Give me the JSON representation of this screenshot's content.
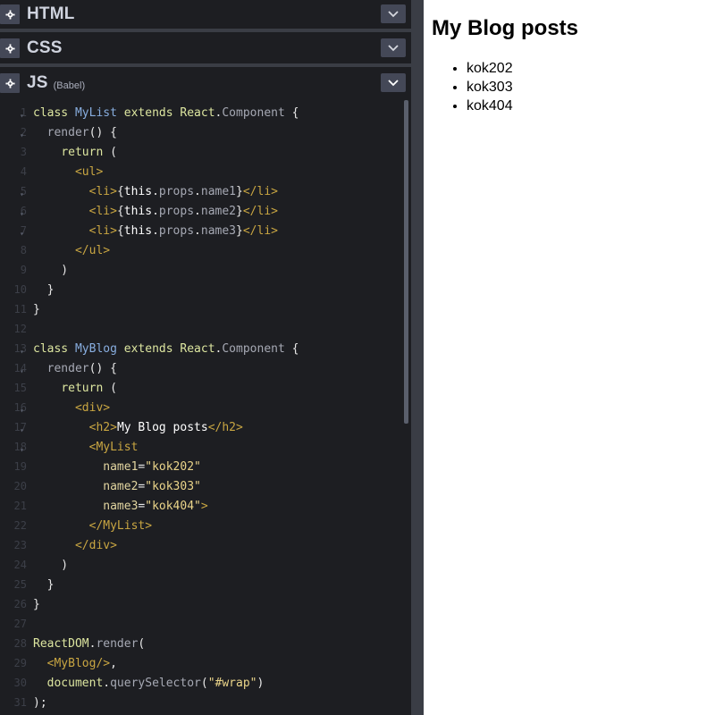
{
  "panels": {
    "html": {
      "title": "HTML"
    },
    "css": {
      "title": "CSS"
    },
    "js": {
      "title": "JS",
      "subtitle": "(Babel)"
    }
  },
  "icons": {
    "settings": "gear-icon",
    "collapse": "chevron-down-icon"
  },
  "colors": {
    "editor_bg": "#1d1e22",
    "divider": "#3a3d45",
    "button_bg": "#444857",
    "keyword": "#dde6a0",
    "class_name": "#88aee0",
    "tag": "#c9a642",
    "string": "#ebd58a"
  },
  "code": [
    {
      "n": "1",
      "fold": true,
      "toks": [
        [
          "kw",
          "class "
        ],
        [
          "cls",
          "MyList"
        ],
        [
          "kw",
          " extends "
        ],
        [
          "kw",
          "React"
        ],
        [
          "pun",
          "."
        ],
        [
          "fn",
          "Component"
        ],
        [
          "pun",
          " {"
        ]
      ]
    },
    {
      "n": "2",
      "fold": true,
      "toks": [
        [
          "pun",
          "  "
        ],
        [
          "fn",
          "render"
        ],
        [
          "pun",
          "() {"
        ]
      ]
    },
    {
      "n": "3",
      "fold": false,
      "toks": [
        [
          "pun",
          "    "
        ],
        [
          "kw",
          "return"
        ],
        [
          "pun",
          " ("
        ]
      ]
    },
    {
      "n": "4",
      "fold": false,
      "toks": [
        [
          "pun",
          "      "
        ],
        [
          "tg",
          "<ul>"
        ]
      ]
    },
    {
      "n": "5",
      "fold": true,
      "toks": [
        [
          "pun",
          "        "
        ],
        [
          "tg",
          "<li>"
        ],
        [
          "pun",
          "{"
        ],
        [
          "ex",
          "this"
        ],
        [
          "pun",
          "."
        ],
        [
          "fn",
          "props"
        ],
        [
          "pun",
          "."
        ],
        [
          "fn",
          "name1"
        ],
        [
          "pun",
          "}"
        ],
        [
          "tg",
          "</li>"
        ]
      ]
    },
    {
      "n": "6",
      "fold": true,
      "toks": [
        [
          "pun",
          "        "
        ],
        [
          "tg",
          "<li>"
        ],
        [
          "pun",
          "{"
        ],
        [
          "ex",
          "this"
        ],
        [
          "pun",
          "."
        ],
        [
          "fn",
          "props"
        ],
        [
          "pun",
          "."
        ],
        [
          "fn",
          "name2"
        ],
        [
          "pun",
          "}"
        ],
        [
          "tg",
          "</li>"
        ]
      ]
    },
    {
      "n": "7",
      "fold": true,
      "toks": [
        [
          "pun",
          "        "
        ],
        [
          "tg",
          "<li>"
        ],
        [
          "pun",
          "{"
        ],
        [
          "ex",
          "this"
        ],
        [
          "pun",
          "."
        ],
        [
          "fn",
          "props"
        ],
        [
          "pun",
          "."
        ],
        [
          "fn",
          "name3"
        ],
        [
          "pun",
          "}"
        ],
        [
          "tg",
          "</li>"
        ]
      ]
    },
    {
      "n": "8",
      "fold": false,
      "toks": [
        [
          "pun",
          "      "
        ],
        [
          "tg",
          "</ul>"
        ]
      ]
    },
    {
      "n": "9",
      "fold": false,
      "toks": [
        [
          "pun",
          "    )"
        ]
      ]
    },
    {
      "n": "10",
      "fold": false,
      "toks": [
        [
          "pun",
          "  }"
        ]
      ]
    },
    {
      "n": "11",
      "fold": false,
      "toks": [
        [
          "pun",
          "}"
        ]
      ]
    },
    {
      "n": "12",
      "fold": false,
      "toks": []
    },
    {
      "n": "13",
      "fold": true,
      "toks": [
        [
          "kw",
          "class "
        ],
        [
          "cls",
          "MyBlog"
        ],
        [
          "kw",
          " extends "
        ],
        [
          "kw",
          "React"
        ],
        [
          "pun",
          "."
        ],
        [
          "fn",
          "Component"
        ],
        [
          "pun",
          " {"
        ]
      ]
    },
    {
      "n": "14",
      "fold": true,
      "toks": [
        [
          "pun",
          "  "
        ],
        [
          "fn",
          "render"
        ],
        [
          "pun",
          "() {"
        ]
      ]
    },
    {
      "n": "15",
      "fold": false,
      "toks": [
        [
          "pun",
          "    "
        ],
        [
          "kw",
          "return"
        ],
        [
          "pun",
          " ("
        ]
      ]
    },
    {
      "n": "16",
      "fold": true,
      "toks": [
        [
          "pun",
          "      "
        ],
        [
          "tg",
          "<div>"
        ]
      ]
    },
    {
      "n": "17",
      "fold": true,
      "toks": [
        [
          "pun",
          "        "
        ],
        [
          "tg",
          "<h2>"
        ],
        [
          "ex",
          "My Blog posts"
        ],
        [
          "tg",
          "</h2>"
        ]
      ]
    },
    {
      "n": "18",
      "fold": true,
      "toks": [
        [
          "pun",
          "        "
        ],
        [
          "tg",
          "<MyList"
        ]
      ]
    },
    {
      "n": "19",
      "fold": false,
      "toks": [
        [
          "pun",
          "          "
        ],
        [
          "at",
          "name1"
        ],
        [
          "pun",
          "="
        ],
        [
          "st",
          "\"kok202\""
        ]
      ]
    },
    {
      "n": "20",
      "fold": false,
      "toks": [
        [
          "pun",
          "          "
        ],
        [
          "at",
          "name2"
        ],
        [
          "pun",
          "="
        ],
        [
          "st",
          "\"kok303\""
        ]
      ]
    },
    {
      "n": "21",
      "fold": false,
      "toks": [
        [
          "pun",
          "          "
        ],
        [
          "at",
          "name3"
        ],
        [
          "pun",
          "="
        ],
        [
          "st",
          "\"kok404\""
        ],
        [
          "tg",
          ">"
        ]
      ]
    },
    {
      "n": "22",
      "fold": false,
      "toks": [
        [
          "pun",
          "        "
        ],
        [
          "tg",
          "</MyList>"
        ]
      ]
    },
    {
      "n": "23",
      "fold": false,
      "toks": [
        [
          "pun",
          "      "
        ],
        [
          "tg",
          "</div>"
        ]
      ]
    },
    {
      "n": "24",
      "fold": false,
      "toks": [
        [
          "pun",
          "    )"
        ]
      ]
    },
    {
      "n": "25",
      "fold": false,
      "toks": [
        [
          "pun",
          "  }"
        ]
      ]
    },
    {
      "n": "26",
      "fold": false,
      "toks": [
        [
          "pun",
          "}"
        ]
      ]
    },
    {
      "n": "27",
      "fold": false,
      "toks": []
    },
    {
      "n": "28",
      "fold": false,
      "toks": [
        [
          "kw",
          "ReactDOM"
        ],
        [
          "pun",
          "."
        ],
        [
          "fn",
          "render"
        ],
        [
          "pun",
          "("
        ]
      ]
    },
    {
      "n": "29",
      "fold": false,
      "toks": [
        [
          "pun",
          "  "
        ],
        [
          "tg",
          "<MyBlog/>"
        ],
        [
          "pun",
          ","
        ]
      ]
    },
    {
      "n": "30",
      "fold": false,
      "toks": [
        [
          "pun",
          "  "
        ],
        [
          "kw",
          "document"
        ],
        [
          "pun",
          "."
        ],
        [
          "fn",
          "querySelector"
        ],
        [
          "pun",
          "("
        ],
        [
          "st",
          "\"#wrap\""
        ],
        [
          "pun",
          ")"
        ]
      ]
    },
    {
      "n": "31",
      "fold": false,
      "toks": [
        [
          "pun",
          ");"
        ]
      ]
    }
  ],
  "preview": {
    "heading": "My Blog posts",
    "items": [
      "kok202",
      "kok303",
      "kok404"
    ]
  }
}
